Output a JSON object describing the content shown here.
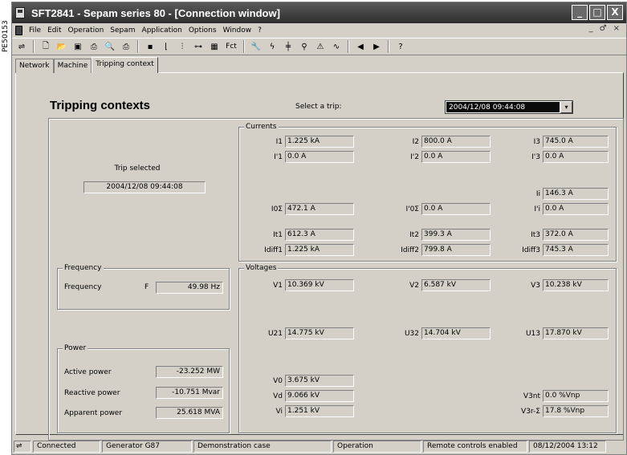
{
  "side_label": "PE50153",
  "window": {
    "title": "SFT2841 - Sepam series 80 - [Connection window]",
    "buttons": [
      "_",
      "□",
      "X"
    ]
  },
  "menu": {
    "items": [
      "File",
      "Edit",
      "Operation",
      "Sepam",
      "Application",
      "Options",
      "Window",
      "?"
    ],
    "right_buttons": [
      "_",
      "♂",
      "×"
    ]
  },
  "toolbar": {
    "fct_label": "Fct",
    "icons": [
      "connect-icon",
      "new-icon",
      "open-icon",
      "save-icon",
      "print-icon",
      "print-preview-icon",
      "print-setup-icon",
      "disk-icon",
      "curve-icon",
      "hardware-icon",
      "logic-icon",
      "grid-icon",
      "wrench-icon",
      "lightning-icon",
      "network-icon",
      "tools-icon",
      "alarm-icon",
      "waveform-icon",
      "back-icon",
      "forward-icon",
      "help-icon"
    ]
  },
  "tabs": [
    {
      "label": "Network",
      "active": false
    },
    {
      "label": "Machine",
      "active": false
    },
    {
      "label": "Tripping context",
      "active": true
    }
  ],
  "page": {
    "title": "Tripping contexts",
    "select_label": "Select a trip:",
    "selected_trip": "2004/12/08 09:44:08",
    "dropdown_arrow": "▾"
  },
  "trip_selected": {
    "label": "Trip selected",
    "value": "2004/12/08 09:44:08"
  },
  "frequency": {
    "legend": "Frequency",
    "label": "Frequency",
    "symbol": "F",
    "value": "49.98 Hz"
  },
  "power": {
    "legend": "Power",
    "active_label": "Active power",
    "active_value": "-23.252 MW",
    "reactive_label": "Reactive power",
    "reactive_value": "-10.751 Mvar",
    "apparent_label": "Apparent power",
    "apparent_value": "25.618 MVA"
  },
  "currents": {
    "legend": "Currents",
    "I1": {
      "label": "I1",
      "value": "1.225 kA"
    },
    "I2": {
      "label": "I2",
      "value": "800.0 A"
    },
    "I3": {
      "label": "I3",
      "value": "745.0 A"
    },
    "Ip1": {
      "label": "I'1",
      "value": "0.0 A"
    },
    "Ip2": {
      "label": "I'2",
      "value": "0.0 A"
    },
    "Ip3": {
      "label": "I'3",
      "value": "0.0 A"
    },
    "Ii": {
      "label": "Ii",
      "value": "146.3 A"
    },
    "Ipi": {
      "label": "I'i",
      "value": "0.0 A"
    },
    "I0S": {
      "label": "I0Σ",
      "value": "472.1 A"
    },
    "Ip0S": {
      "label": "I'0Σ",
      "value": "0.0 A"
    },
    "It1": {
      "label": "It1",
      "value": "612.3 A"
    },
    "It2": {
      "label": "It2",
      "value": "399.3 A"
    },
    "It3": {
      "label": "It3",
      "value": "372.0 A"
    },
    "Idiff1": {
      "label": "Idiff1",
      "value": "1.225 kA"
    },
    "Idiff2": {
      "label": "Idiff2",
      "value": "799.8 A"
    },
    "Idiff3": {
      "label": "Idiff3",
      "value": "745.3 A"
    }
  },
  "voltages": {
    "legend": "Voltages",
    "V1": {
      "label": "V1",
      "value": "10.369 kV"
    },
    "V2": {
      "label": "V2",
      "value": "6.587 kV"
    },
    "V3": {
      "label": "V3",
      "value": "10.238 kV"
    },
    "U21": {
      "label": "U21",
      "value": "14.775 kV"
    },
    "U32": {
      "label": "U32",
      "value": "14.704 kV"
    },
    "U13": {
      "label": "U13",
      "value": "17.870 kV"
    },
    "V0": {
      "label": "V0",
      "value": "3.675 kV"
    },
    "Vd": {
      "label": "Vd",
      "value": "9.066 kV"
    },
    "Vi": {
      "label": "Vi",
      "value": "1.251 kV"
    },
    "V3nt": {
      "label": "V3nt",
      "value": "0.0 %Vnp"
    },
    "V3rS": {
      "label": "V3r-Σ",
      "value": "17.8 %Vnp"
    }
  },
  "status": {
    "connection": "Connected",
    "device": "Generator G87",
    "case": "Demonstration case",
    "mode": "Operation",
    "remote": "Remote controls enabled",
    "datetime": "08/12/2004 13:12"
  }
}
